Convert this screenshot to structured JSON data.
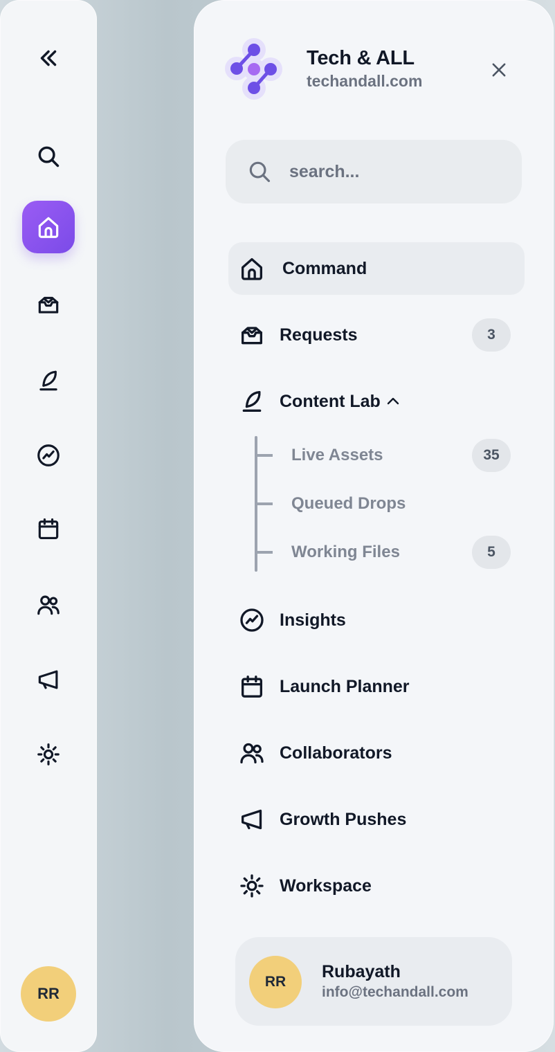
{
  "brand": {
    "name": "Tech & ALL",
    "domain": "techandall.com",
    "accent": "#7b4be8",
    "logo_icon": "molecule-logo-icon"
  },
  "search": {
    "placeholder": "search..."
  },
  "nav": [
    {
      "label": "Command",
      "icon": "home-icon",
      "active": true
    },
    {
      "label": "Requests",
      "icon": "inbox-icon",
      "badge": "3"
    },
    {
      "label": "Content Lab",
      "icon": "feather-icon",
      "expanded": true,
      "children": [
        {
          "label": "Live Assets",
          "badge": "35"
        },
        {
          "label": "Queued Drops"
        },
        {
          "label": "Working Files",
          "badge": "5"
        }
      ]
    },
    {
      "label": "Insights",
      "icon": "trend-icon"
    },
    {
      "label": "Launch Planner",
      "icon": "calendar-icon"
    },
    {
      "label": "Collaborators",
      "icon": "users-icon"
    },
    {
      "label": "Growth Pushes",
      "icon": "megaphone-icon"
    },
    {
      "label": "Workspace",
      "icon": "sun-icon"
    }
  ],
  "user": {
    "initials": "RR",
    "name": "Rubayath",
    "email": "info@techandall.com",
    "avatar_color": "#f2cf7a"
  }
}
